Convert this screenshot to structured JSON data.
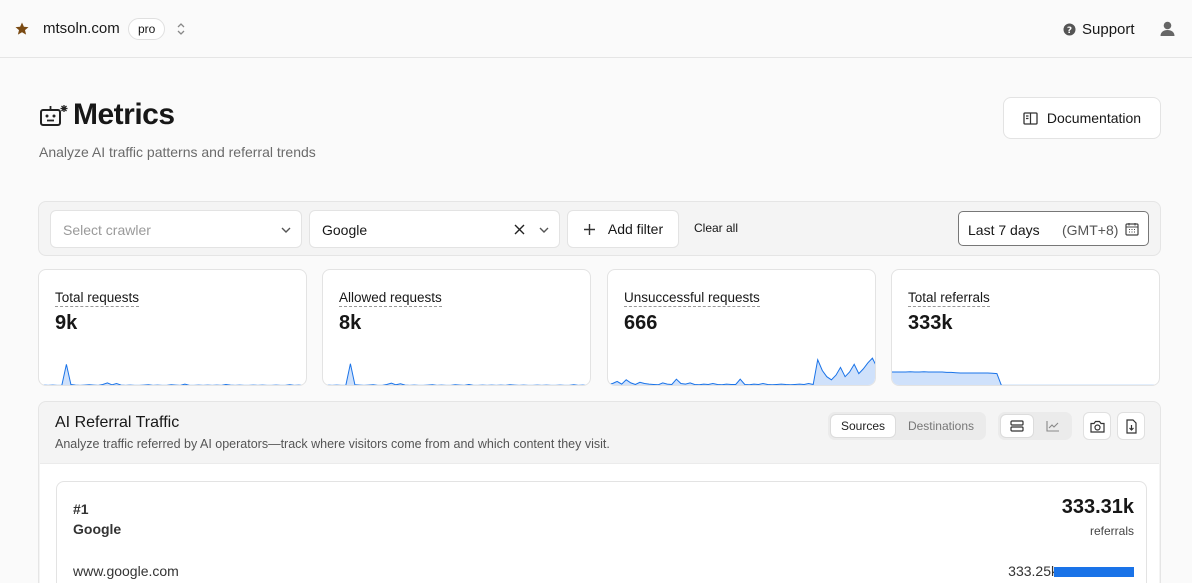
{
  "topbar": {
    "domain": "mtsoln.com",
    "plan_badge": "pro",
    "support_label": "Support",
    "icons": [
      "star-icon",
      "switcher-icon",
      "help-icon",
      "user-icon"
    ]
  },
  "header": {
    "title": "Metrics",
    "subtitle": "Analyze AI traffic patterns and referral trends",
    "documentation_label": "Documentation",
    "icons": [
      "robot-icon",
      "book-icon"
    ]
  },
  "filters": {
    "crawler_placeholder": "Select crawler",
    "operator_value": "Google",
    "add_filter_label": "Add filter",
    "clear_all_label": "Clear all",
    "date_range": "Last 7 days",
    "timezone": "(GMT+8)"
  },
  "metrics": [
    {
      "label": "Total requests",
      "value": "9k"
    },
    {
      "label": "Allowed requests",
      "value": "8k"
    },
    {
      "label": "Unsuccessful requests",
      "value": "666"
    },
    {
      "label": "Total referrals",
      "value": "333k"
    }
  ],
  "sparklines": {
    "color": "#1a73e8",
    "fill": "#cfe1fb",
    "series": [
      [
        0.02,
        0.03,
        0.02,
        0.03,
        0.02,
        0.02,
        0.7,
        0.05,
        0.03,
        0.02,
        0.03,
        0.04,
        0.03,
        0.02,
        0.05,
        0.1,
        0.04,
        0.08,
        0.03,
        0.02,
        0.03,
        0.02,
        0.02,
        0.03,
        0.04,
        0.02,
        0.03,
        0.02,
        0.02,
        0.04,
        0.03,
        0.02,
        0.06,
        0.02,
        0.02,
        0.03,
        0.02,
        0.03,
        0.02,
        0.03,
        0.02,
        0.05,
        0.03,
        0.02,
        0.03,
        0.02,
        0.02,
        0.03,
        0.02,
        0.03,
        0.02,
        0.02,
        0.03,
        0.02,
        0.02,
        0.04,
        0.02,
        0.03,
        0.02,
        0.03
      ],
      [
        0.02,
        0.03,
        0.02,
        0.03,
        0.02,
        0.02,
        0.72,
        0.04,
        0.03,
        0.02,
        0.03,
        0.04,
        0.02,
        0.02,
        0.05,
        0.09,
        0.04,
        0.07,
        0.03,
        0.02,
        0.03,
        0.02,
        0.02,
        0.03,
        0.04,
        0.02,
        0.03,
        0.02,
        0.02,
        0.04,
        0.03,
        0.02,
        0.05,
        0.02,
        0.02,
        0.03,
        0.02,
        0.03,
        0.02,
        0.03,
        0.02,
        0.04,
        0.03,
        0.02,
        0.03,
        0.02,
        0.02,
        0.03,
        0.02,
        0.03,
        0.02,
        0.02,
        0.03,
        0.02,
        0.02,
        0.04,
        0.02,
        0.03,
        0.02,
        0.03
      ],
      [
        0.05,
        0.08,
        0.15,
        0.06,
        0.2,
        0.1,
        0.05,
        0.12,
        0.08,
        0.06,
        0.05,
        0.04,
        0.1,
        0.06,
        0.05,
        0.22,
        0.08,
        0.06,
        0.1,
        0.05,
        0.04,
        0.06,
        0.05,
        0.08,
        0.05,
        0.04,
        0.06,
        0.05,
        0.05,
        0.22,
        0.05,
        0.04,
        0.06,
        0.05,
        0.08,
        0.05,
        0.04,
        0.05,
        0.06,
        0.05,
        0.04,
        0.05,
        0.06,
        0.05,
        0.08,
        0.05,
        0.85,
        0.5,
        0.3,
        0.2,
        0.35,
        0.6,
        0.3,
        0.45,
        0.7,
        0.4,
        0.55,
        0.75,
        0.9,
        0.6
      ],
      [
        0.45,
        0.45,
        0.45,
        0.45,
        0.46,
        0.45,
        0.45,
        0.46,
        0.45,
        0.45,
        0.45,
        0.45,
        0.44,
        0.44,
        0.43,
        0.42,
        0.42,
        0.42,
        0.42,
        0.42,
        0.42,
        0.42,
        0.41,
        0.4,
        0.02,
        0.02,
        0.02,
        0.02,
        0.02,
        0.02,
        0.02,
        0.02,
        0.02,
        0.02,
        0.02,
        0.02,
        0.02,
        0.02,
        0.02,
        0.02,
        0.02,
        0.02,
        0.02,
        0.02,
        0.02,
        0.02,
        0.02,
        0.02,
        0.02,
        0.02,
        0.02,
        0.02,
        0.02,
        0.02,
        0.02,
        0.02,
        0.02,
        0.02,
        0.02,
        0.02
      ]
    ]
  },
  "referral": {
    "title": "AI Referral Traffic",
    "subtitle": "Analyze traffic referred by AI operators—track where visitors come from and which content they visit.",
    "tabs": [
      "Sources",
      "Destinations"
    ],
    "active_tab": "Sources",
    "view_icons": [
      "list-view-icon",
      "chart-view-icon",
      "camera-icon",
      "export-icon"
    ],
    "top_source": {
      "rank": "#1",
      "name": "Google",
      "total": "333.31k",
      "unit": "referrals",
      "rows": [
        {
          "label": "www.google.com",
          "value": "333.25k",
          "share": 1.0
        }
      ]
    }
  }
}
